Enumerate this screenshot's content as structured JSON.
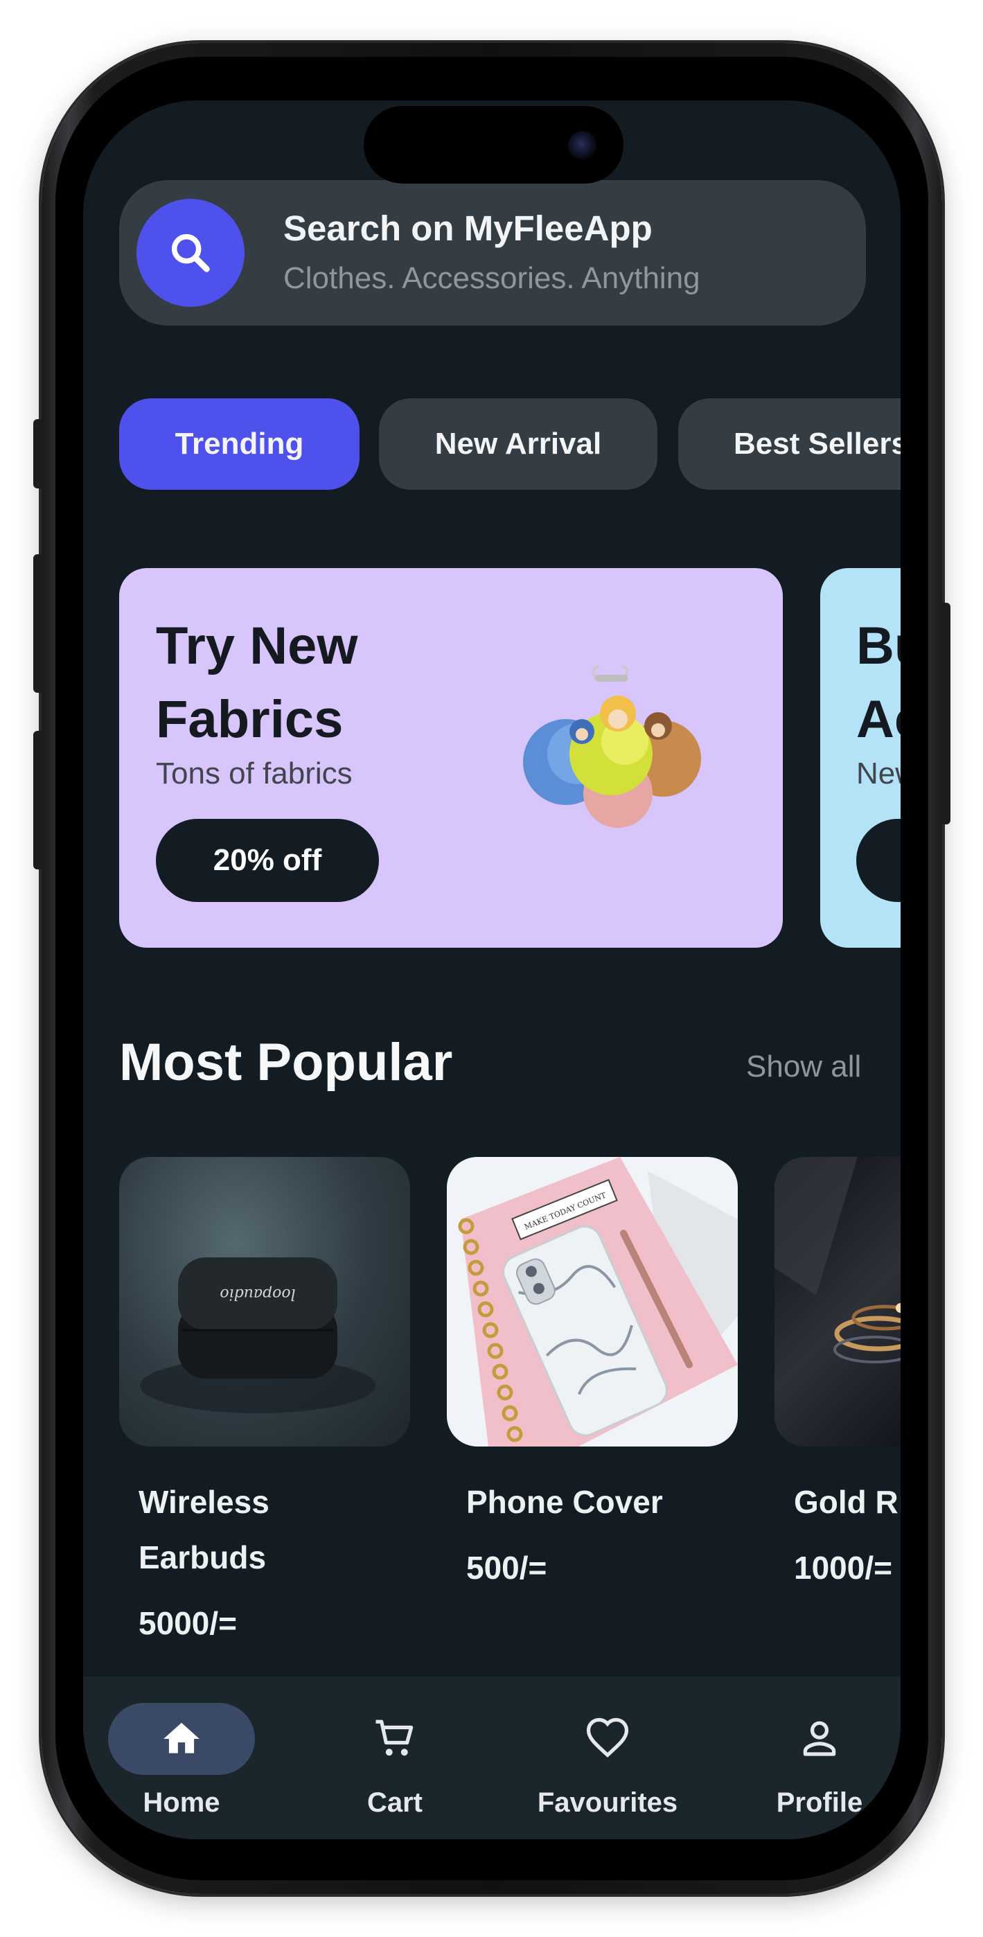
{
  "search": {
    "title": "Search on MyFleeApp",
    "subtitle": "Clothes. Accessories. Anything",
    "icon": "search-icon"
  },
  "chips": [
    {
      "label": "Trending",
      "active": true
    },
    {
      "label": "New Arrival",
      "active": false
    },
    {
      "label": "Best Sellers",
      "active": false
    }
  ],
  "promos": [
    {
      "title_line1": "Try New",
      "title_line2": "Fabrics",
      "subtitle": "Tons of fabrics",
      "button": "20% off",
      "bg": "#d8c5fb"
    },
    {
      "title_line1": "Bu",
      "title_line2": "Ac",
      "subtitle": "New",
      "button": "",
      "bg": "#b4e3f8"
    }
  ],
  "section": {
    "title": "Most Popular",
    "show_all": "Show all"
  },
  "products": [
    {
      "name_line1": "Wireless",
      "name_line2": "Earbuds",
      "price": "5000/=",
      "brand_text": "loopaudio"
    },
    {
      "name_line1": "Phone Cover",
      "name_line2": "",
      "price": "500/=",
      "notebook_text": "MAKE TODAY COUNT"
    },
    {
      "name_line1": "Gold Ri",
      "name_line2": "",
      "price": "1000/="
    }
  ],
  "nav": [
    {
      "label": "Home",
      "icon": "home-icon",
      "active": true
    },
    {
      "label": "Cart",
      "icon": "cart-icon",
      "active": false
    },
    {
      "label": "Favourites",
      "icon": "heart-icon",
      "active": false
    },
    {
      "label": "Profile",
      "icon": "person-icon",
      "active": false
    }
  ],
  "colors": {
    "background": "#121c22",
    "accent": "#4f51ed",
    "surface": "#343d44",
    "nav_active": "#3a4a66"
  }
}
